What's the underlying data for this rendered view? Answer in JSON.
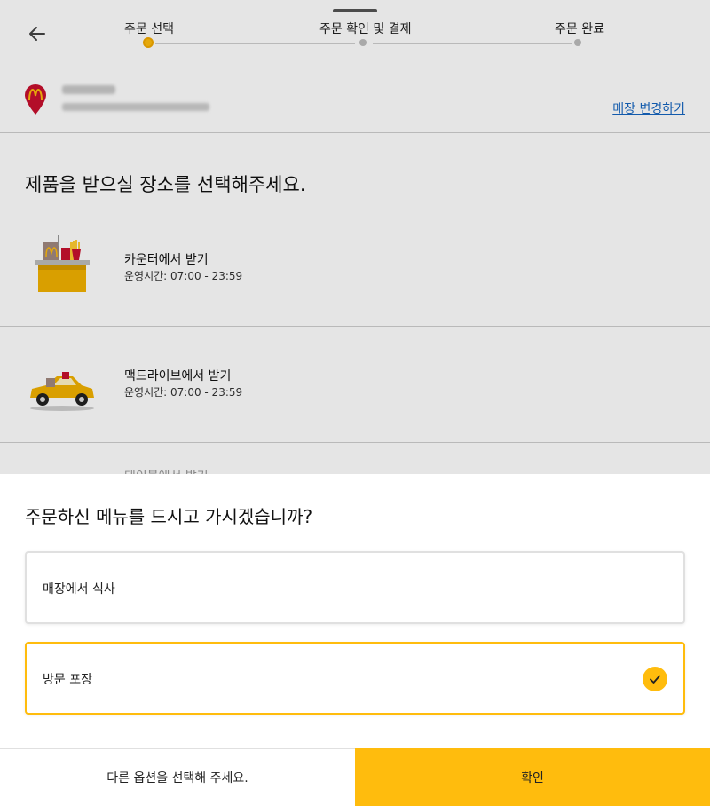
{
  "stepper": {
    "steps": [
      {
        "label": "주문 선택",
        "active": true
      },
      {
        "label": "주문 확인 및 결제",
        "active": false
      },
      {
        "label": "주문 완료",
        "active": false
      }
    ]
  },
  "store": {
    "change_label": "매장 변경하기"
  },
  "pickup": {
    "question": "제품을 받으실 장소를 선택해주세요.",
    "options": [
      {
        "title": "카운터에서 받기",
        "hours": "운영시간: 07:00 - 23:59",
        "icon": "counter-icon"
      },
      {
        "title": "맥드라이브에서 받기",
        "hours": "운영시간: 07:00 - 23:59",
        "icon": "drive-car-icon"
      },
      {
        "title": "테이블에서 받기"
      }
    ]
  },
  "sheet": {
    "question": "주문하신 메뉴를 드시고 가시겠습니까?",
    "choices": [
      {
        "label": "매장에서 식사",
        "selected": false
      },
      {
        "label": "방문 포장",
        "selected": true
      }
    ]
  },
  "footer": {
    "secondary_label": "다른 옵션을 선택해 주세요.",
    "primary_label": "확인"
  },
  "colors": {
    "accent": "#ffbc0d",
    "link": "#1565c0"
  }
}
